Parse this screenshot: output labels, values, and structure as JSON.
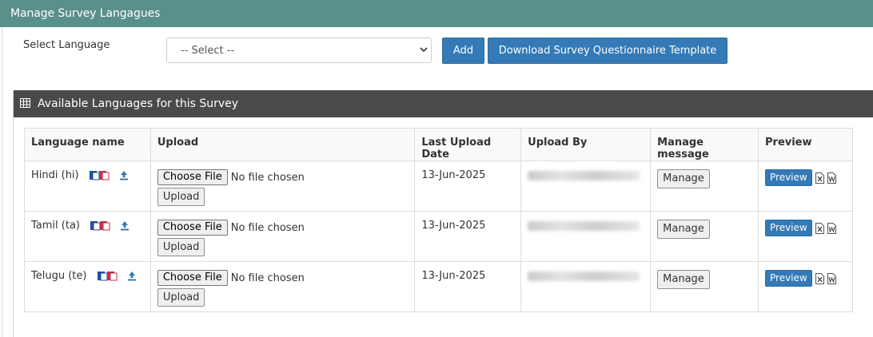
{
  "panel": {
    "title": "Manage Survey Langagues"
  },
  "form": {
    "select_label": "Select Language",
    "select_value": "-- Select --",
    "add_label": "Add",
    "download_label": "Download Survey Questionnaire Template"
  },
  "section": {
    "title": "Available Languages for this Survey"
  },
  "table": {
    "headers": {
      "language": "Language name",
      "upload": "Upload",
      "date": "Last Upload Date",
      "by": "Upload By",
      "manage": "Manage message",
      "preview": "Preview"
    },
    "rows": [
      {
        "language": "Hindi (hi)",
        "choose": "Choose File",
        "no_file": "No file chosen",
        "upload": "Upload",
        "date": "13-Jun-2025",
        "manage": "Manage",
        "preview": "Preview"
      },
      {
        "language": "Tamil (ta)",
        "choose": "Choose File",
        "no_file": "No file chosen",
        "upload": "Upload",
        "date": "13-Jun-2025",
        "manage": "Manage",
        "preview": "Preview"
      },
      {
        "language": "Telugu (te)",
        "choose": "Choose File",
        "no_file": "No file chosen",
        "upload": "Upload",
        "date": "13-Jun-2025",
        "manage": "Manage",
        "preview": "Preview"
      }
    ]
  },
  "icons": [
    "copy-icon",
    "upload-icon",
    "excel-icon",
    "word-icon",
    "grid-icon",
    "chevron-down-icon"
  ],
  "colors": {
    "panel_header": "#5a8f8a",
    "section_header": "#4a4a4a",
    "primary": "#337ab7",
    "copy_blue": "#1f4e9c",
    "copy_red": "#c0304a"
  }
}
